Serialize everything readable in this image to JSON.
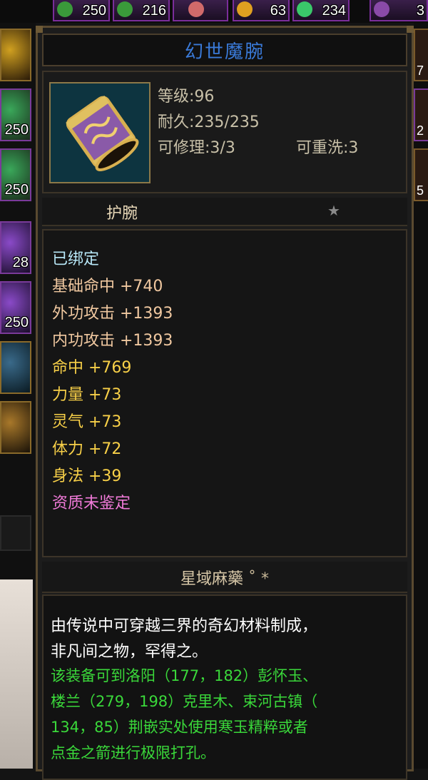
{
  "inventory_top": [
    {
      "count": "250",
      "color": "#3a9a3a"
    },
    {
      "count": "216",
      "color": "#3a9a3a"
    },
    {
      "count": "",
      "color": "#d06a6a"
    },
    {
      "count": "63",
      "color": "#e0a020"
    },
    {
      "count": "234",
      "color": "#3ac86a"
    },
    {
      "count": "3",
      "color": "#8a4aa8"
    }
  ],
  "inventory_left": [
    {
      "count": "",
      "color": "#d0a020"
    },
    {
      "count": "250",
      "color": "#3aa85a"
    },
    {
      "count": "250",
      "color": "#3aa85a"
    },
    {
      "count": "28",
      "color": "#8a4ac8"
    },
    {
      "count": "250",
      "color": "#8a4ac8"
    },
    {
      "count": "",
      "color": "#3a6a8a"
    },
    {
      "count": "",
      "color": "#a8782a"
    }
  ],
  "inventory_right": [
    {
      "count": "7"
    },
    {
      "count": "2"
    },
    {
      "count": "5"
    }
  ],
  "item": {
    "name": "幻世魔腕",
    "level": "等级:96",
    "durability": "耐久:235/235",
    "repairable": "可修理:3/3",
    "rewash": "可重洗:3",
    "type": "护腕",
    "bound": "已绑定",
    "attributes": [
      {
        "text": "基础命中 +740",
        "kind": "base"
      },
      {
        "text": "外功攻击 +1393",
        "kind": "base"
      },
      {
        "text": "内功攻击 +1393",
        "kind": "base"
      },
      {
        "text": "命中 +769",
        "kind": "extra"
      },
      {
        "text": "力量 +73",
        "kind": "extra"
      },
      {
        "text": "灵气 +73",
        "kind": "extra"
      },
      {
        "text": "体力 +72",
        "kind": "extra"
      },
      {
        "text": "身法 +39",
        "kind": "extra"
      }
    ],
    "quality": "资质未鉴定",
    "set_name": "星域麻藥",
    "set_mark": "˚ *",
    "description_white": [
      "由传说中可穿越三界的奇幻材料制成，",
      "非凡间之物，罕得之。"
    ],
    "description_green": [
      "该装备可到洛阳（177，182）彭怀玉、",
      "楼兰（279，198）克里木、束河古镇（",
      "134，85）荆嵌实处使用寒玉精粹或者",
      "点金之箭进行极限打孔。"
    ]
  },
  "colors": {
    "title": "#3a7ad8",
    "bound": "#b8e8f8",
    "base_attr": "#f0c8a0",
    "extra_attr": "#f8d048",
    "quality": "#f07ad8",
    "desc_green": "#3ad83a"
  }
}
